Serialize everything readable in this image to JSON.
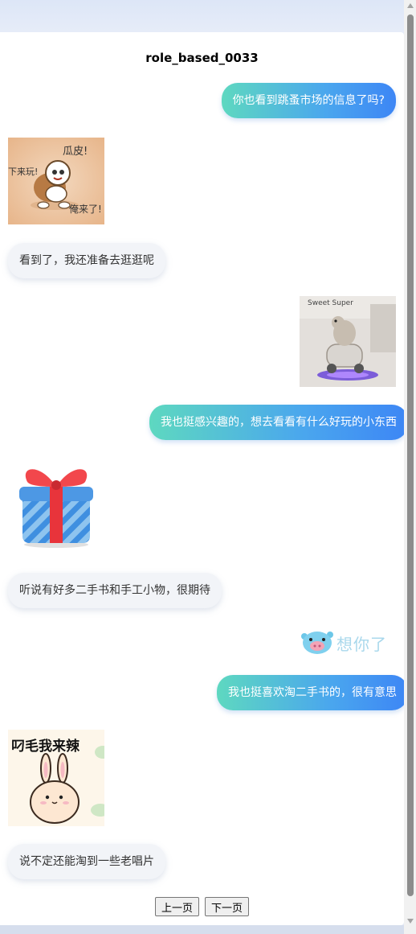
{
  "conversation": {
    "title": "role_based_0033"
  },
  "messages": [
    {
      "type": "text",
      "side": "out",
      "text": "你也看到跳蚤市场的信息了吗?"
    },
    {
      "type": "sticker",
      "side": "in",
      "sticker": "turtle-astronaut-sticker",
      "captions": [
        "瓜皮!",
        "下来玩!",
        "俺来了!"
      ]
    },
    {
      "type": "text",
      "side": "in",
      "text": "看到了，我还准备去逛逛呢"
    },
    {
      "type": "sticker",
      "side": "out",
      "sticker": "hamster-scooter-sticker",
      "captions": [
        "Sweet Super"
      ]
    },
    {
      "type": "text",
      "side": "out",
      "text": "我也挺感兴趣的，想去看看有什么好玩的小东西"
    },
    {
      "type": "sticker",
      "side": "in",
      "sticker": "gift-box-sticker",
      "captions": []
    },
    {
      "type": "text",
      "side": "in",
      "text": "听说有好多二手书和手工小物，很期待"
    },
    {
      "type": "sticker",
      "side": "out",
      "sticker": "miss-you-pig-sticker",
      "captions": [
        "想你了"
      ]
    },
    {
      "type": "text",
      "side": "out",
      "text": "我也挺喜欢淘二手书的，很有意思"
    },
    {
      "type": "sticker",
      "side": "in",
      "sticker": "bunny-coming-sticker",
      "captions": [
        "叼毛我来辣"
      ]
    },
    {
      "type": "text",
      "side": "in",
      "text": "说不定还能淘到一些老唱片"
    }
  ],
  "pager": {
    "prev_label": "上一页",
    "next_label": "下一页"
  },
  "colors": {
    "outgoing_gradient_start": "#5ed8c0",
    "outgoing_gradient_end": "#3d86f5",
    "incoming_bg": "#f2f4f8"
  }
}
